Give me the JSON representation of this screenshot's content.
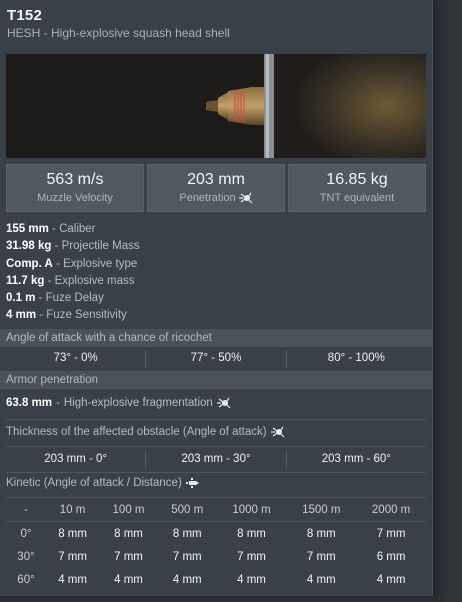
{
  "header": {
    "title": "T152",
    "subtitle": "HESH - High-explosive squash head shell"
  },
  "stats": [
    {
      "value": "563 m/s",
      "label": "Muzzle Velocity"
    },
    {
      "value": "203 mm",
      "label": "Penetration"
    },
    {
      "value": "16.85 kg",
      "label": "TNT equivalent"
    }
  ],
  "properties": [
    {
      "value": "155 mm",
      "label": "Caliber"
    },
    {
      "value": "31.98 kg",
      "label": "Projectile Mass"
    },
    {
      "value": "Comp. A",
      "label": "Explosive type"
    },
    {
      "value": "11.7 kg",
      "label": "Explosive mass"
    },
    {
      "value": "0.1 m",
      "label": "Fuze Delay"
    },
    {
      "value": "4 mm",
      "label": "Fuze Sensitivity"
    }
  ],
  "ricochet": {
    "header": "Angle of attack with a chance of ricochet",
    "cells": [
      "73° - 0%",
      "77° - 50%",
      "80° - 100%"
    ]
  },
  "armor": {
    "header": "Armor penetration",
    "frag_value": "63.8 mm",
    "frag_label": "High-explosive fragmentation"
  },
  "thickness": {
    "header": "Thickness of the affected obstacle (Angle of attack)",
    "cells": [
      "203 mm - 0°",
      "203 mm - 30°",
      "203 mm - 60°"
    ]
  },
  "kinetic": {
    "header": "Kinetic (Angle of attack / Distance)",
    "columns": [
      "-",
      "10 m",
      "100 m",
      "500 m",
      "1000 m",
      "1500 m",
      "2000 m"
    ],
    "rows": [
      {
        "angle": "0°",
        "values": [
          "8 mm",
          "8 mm",
          "8 mm",
          "8 mm",
          "8 mm",
          "7 mm"
        ]
      },
      {
        "angle": "30°",
        "values": [
          "7 mm",
          "7 mm",
          "7 mm",
          "7 mm",
          "7 mm",
          "6 mm"
        ]
      },
      {
        "angle": "60°",
        "values": [
          "4 mm",
          "4 mm",
          "4 mm",
          "4 mm",
          "4 mm",
          "4 mm"
        ]
      }
    ]
  },
  "icons": {
    "explosion": "explosion-icon",
    "kinetic": "kinetic-shell-icon"
  }
}
